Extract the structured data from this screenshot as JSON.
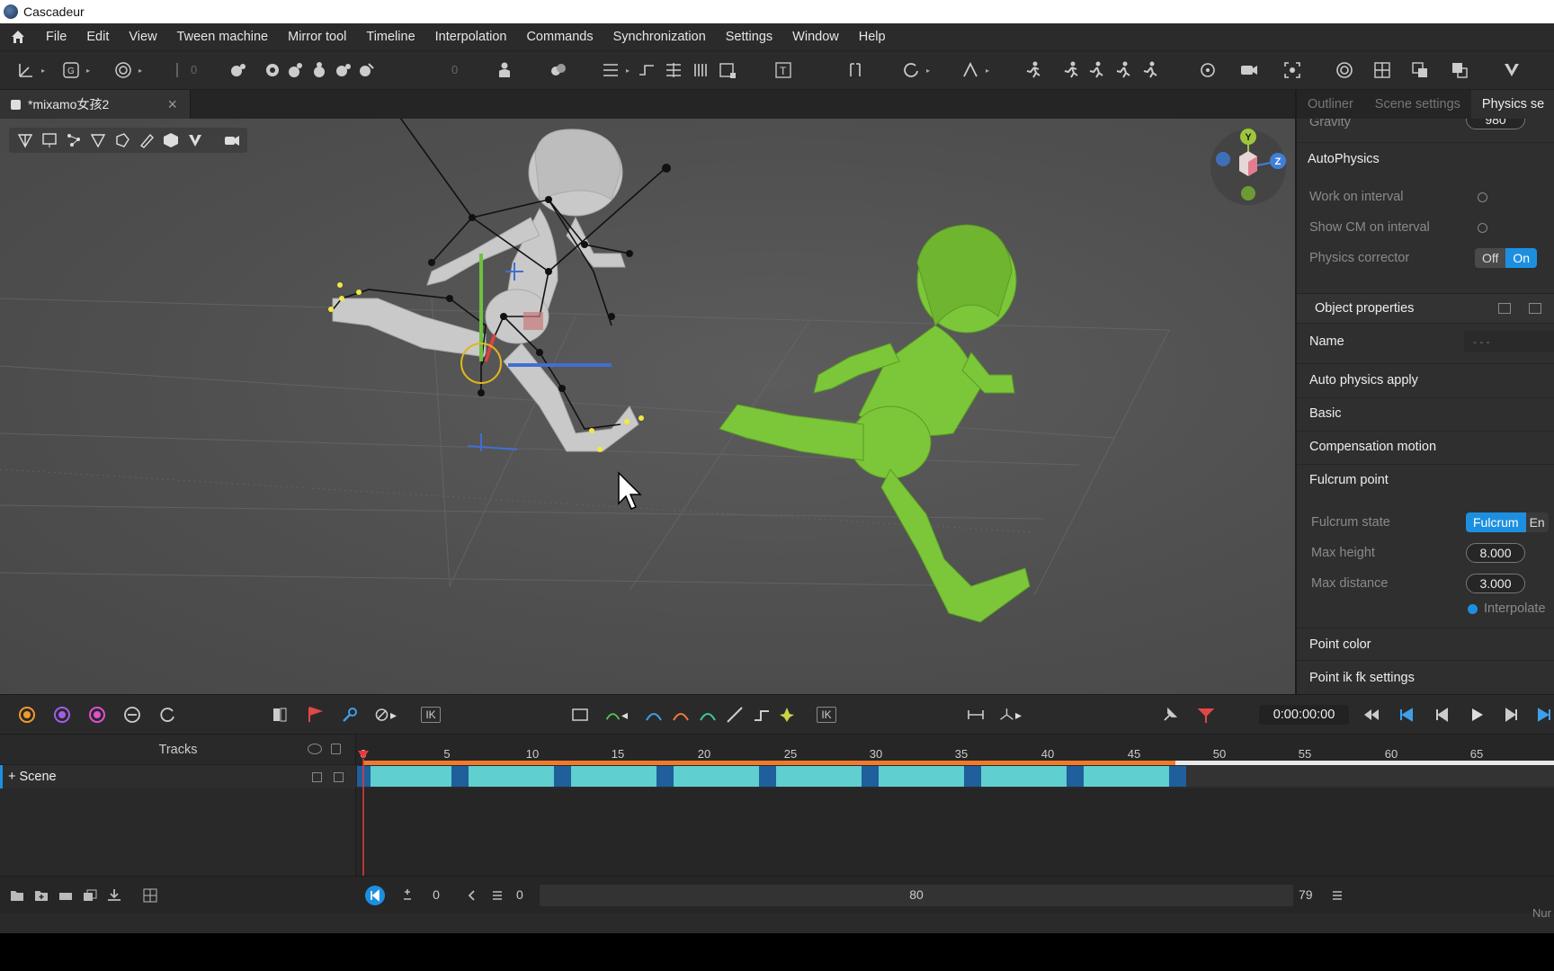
{
  "window": {
    "title": "Cascadeur"
  },
  "menu": {
    "items": [
      "File",
      "Edit",
      "View",
      "Tween machine",
      "Mirror tool",
      "Timeline",
      "Interpolation",
      "Commands",
      "Synchronization",
      "Settings",
      "Window",
      "Help"
    ]
  },
  "toolbar": {
    "spin_a": "0",
    "spin_b": "0"
  },
  "document": {
    "tab_label": "*mixamo女孩2"
  },
  "right_panel": {
    "tabs": [
      "Outliner",
      "Scene settings",
      "Physics se"
    ],
    "gravity_label": "Gravity",
    "gravity_value": "980",
    "autophysics": {
      "title": "AutoPhysics",
      "work_on_interval": "Work on interval",
      "show_cm_on_interval": "Show CM on interval",
      "physics_corrector": "Physics corrector",
      "off_label": "Off",
      "on_label": "On"
    },
    "object_properties": {
      "title": "Object properties",
      "name_label": "Name",
      "name_value": "- - -",
      "auto_physics_apply": "Auto physics apply",
      "basic": "Basic",
      "compensation_motion": "Compensation motion",
      "fulcrum_point": "Fulcrum point",
      "fulcrum_state_label": "Fulcrum state",
      "fulcrum_state_value": "Fulcrum",
      "fulcrum_state_other": "En",
      "max_height_label": "Max height",
      "max_height_value": "8.000",
      "max_distance_label": "Max distance",
      "max_distance_value": "3.000",
      "interpolate_label": "Interpolate",
      "point_color": "Point color",
      "point_ik_fk_settings": "Point ik fk settings"
    }
  },
  "viewport": {
    "gizmo_axes": {
      "y": "Y",
      "z": "Z"
    }
  },
  "timeline": {
    "ik_label": "IK",
    "ik_label_2": "IK",
    "current_time": "0:00:00:00",
    "tracks_title": "Tracks",
    "scene_track": "+ Scene",
    "ruler_ticks": [
      "0",
      "5",
      "10",
      "15",
      "20",
      "25",
      "30",
      "35",
      "40",
      "45",
      "50",
      "55",
      "60",
      "65"
    ],
    "frame_start": "0",
    "frame_cursor": "0",
    "frame_total": "80",
    "frame_end": "79",
    "status_text": "Nur"
  }
}
